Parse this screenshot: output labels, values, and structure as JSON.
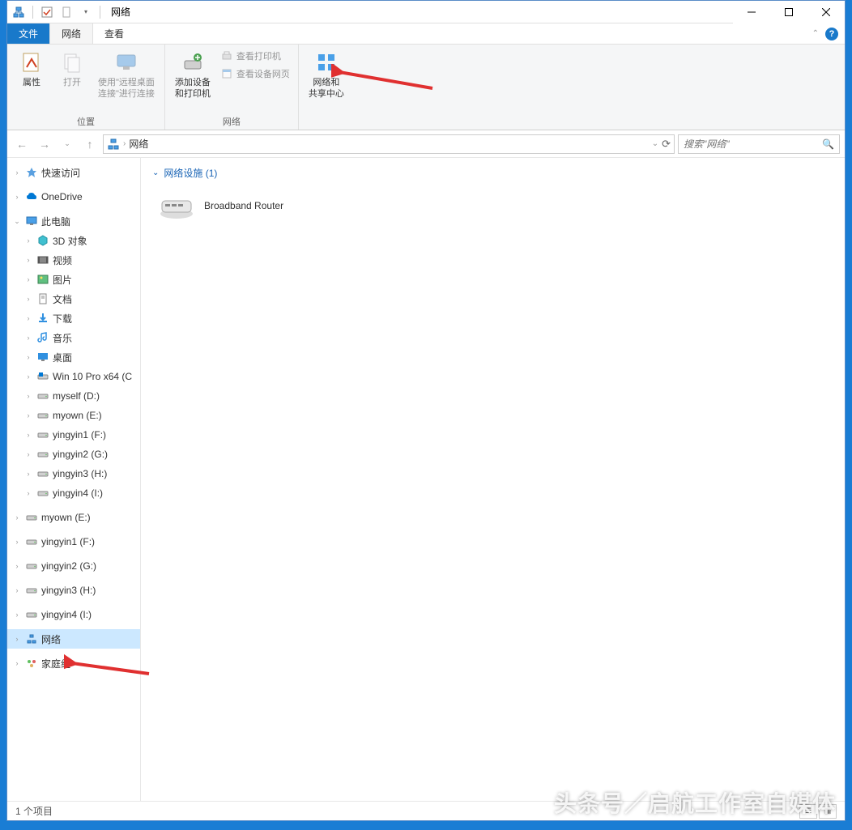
{
  "window": {
    "title": "网络"
  },
  "tabs": {
    "file": "文件",
    "network": "网络",
    "view": "查看"
  },
  "ribbon": {
    "group_location": "位置",
    "group_network": "网络",
    "btn_properties": "属性",
    "btn_open": "打开",
    "btn_remote_desktop": "使用\"远程桌面\n连接\"进行连接",
    "btn_add_device": "添加设备\n和打印机",
    "btn_view_printers": "查看打印机",
    "btn_view_device_page": "查看设备网页",
    "btn_network_center": "网络和\n共享中心"
  },
  "address": {
    "location": "网络"
  },
  "search": {
    "placeholder": "搜索\"网络\""
  },
  "tree": {
    "quick_access": "快速访问",
    "onedrive": "OneDrive",
    "this_pc": "此电脑",
    "objects_3d": "3D 对象",
    "videos": "视频",
    "pictures": "图片",
    "documents": "文档",
    "downloads": "下载",
    "music": "音乐",
    "desktop": "桌面",
    "drive_c": "Win 10 Pro x64 (C",
    "drive_d": "myself (D:)",
    "drive_e": "myown (E:)",
    "drive_f": "yingyin1 (F:)",
    "drive_g": "yingyin2 (G:)",
    "drive_h": "yingyin3 (H:)",
    "drive_i": "yingyin4 (I:)",
    "loc_myown": "myown (E:)",
    "loc_yy1": "yingyin1 (F:)",
    "loc_yy2": "yingyin2 (G:)",
    "loc_yy3": "yingyin3 (H:)",
    "loc_yy4": "yingyin4 (I:)",
    "network": "网络",
    "homegroup": "家庭组"
  },
  "content": {
    "group_header": "网络设施 (1)",
    "device_name": "Broadband Router"
  },
  "status": {
    "items": "1 个项目"
  },
  "watermark": "头条号／启航工作室自媒体"
}
